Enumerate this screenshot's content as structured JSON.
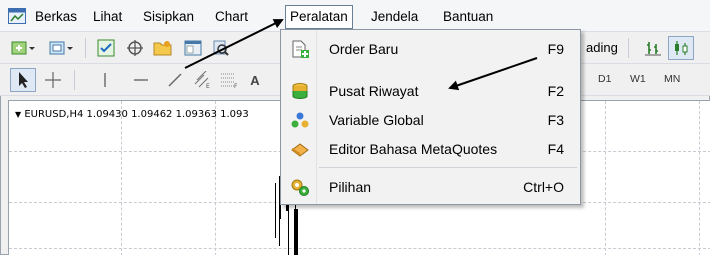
{
  "menubar": {
    "items": [
      "Berkas",
      "Lihat",
      "Sisipkan",
      "Chart",
      "Peralatan",
      "Jendela",
      "Bantuan"
    ],
    "active": "Peralatan"
  },
  "toolbar": {
    "trading_label": "ading",
    "timeframes": [
      "D1",
      "W1",
      "MN"
    ]
  },
  "chart": {
    "info": "EURUSD,H4  1.09430 1.09462 1.09363 1.093"
  },
  "dropdown": {
    "items": [
      {
        "label": "Order Baru",
        "shortcut": "F9",
        "icon": "new-order-icon"
      },
      {
        "label": "Pusat Riwayat",
        "shortcut": "F2",
        "icon": "history-center-icon"
      },
      {
        "label": "Variable Global",
        "shortcut": "F3",
        "icon": "global-variables-icon"
      },
      {
        "label": "Editor Bahasa MetaQuotes",
        "shortcut": "F4",
        "icon": "metaeditor-icon"
      },
      {
        "label": "Pilihan",
        "shortcut": "Ctrl+O",
        "icon": "options-icon"
      }
    ]
  },
  "colors": {
    "arrow": "#000000",
    "active_border": "#6b7f97",
    "menu_bg": "#f2f2f2"
  }
}
